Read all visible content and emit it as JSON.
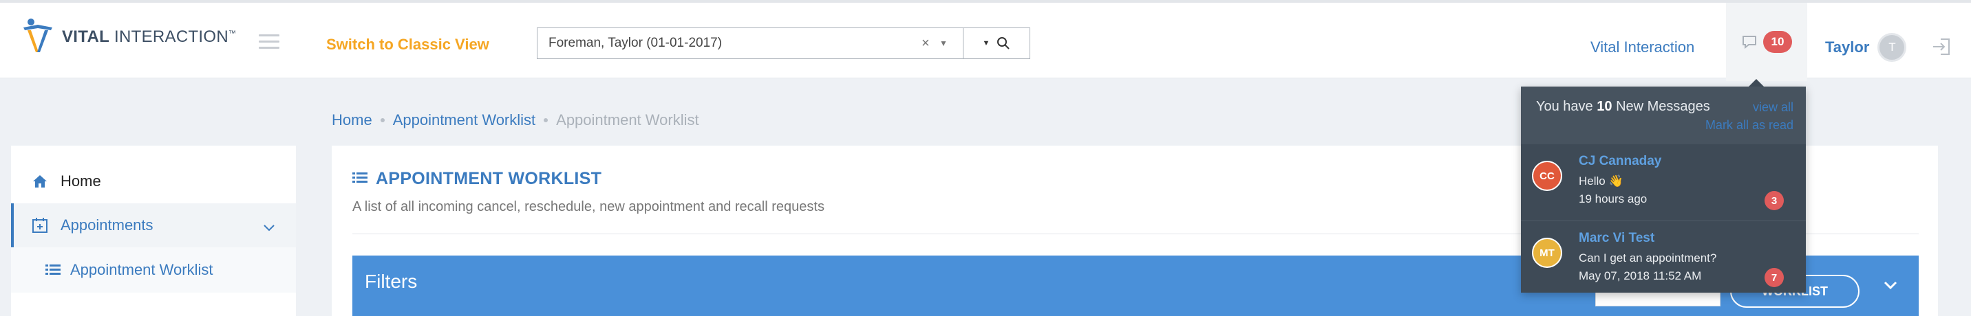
{
  "header": {
    "logo_text_bold": "VITAL",
    "logo_text_rest": "INTERACTION",
    "logo_tm": "™",
    "classic_view": "Switch to Classic View",
    "patient_value": "Foreman, Taylor (01-01-2017)",
    "clear_glyph": "×",
    "vi_link": "Vital Interaction",
    "message_count": "10",
    "user_name": "Taylor",
    "user_initial": "T"
  },
  "breadcrumb": {
    "home": "Home",
    "worklist": "Appointment Worklist",
    "current": "Appointment Worklist"
  },
  "sidebar": {
    "items": [
      {
        "label": "Home",
        "icon": "home-icon"
      },
      {
        "label": "Appointments",
        "icon": "calendar-plus-icon"
      }
    ],
    "sub_items": [
      {
        "label": "Appointment Worklist",
        "icon": "list-icon"
      }
    ]
  },
  "main": {
    "title": "APPOINTMENT WORKLIST",
    "description": "A list of all incoming cancel, reschedule, new appointment and recall requests",
    "filters_title": "Filters",
    "worklist_button": "WORKLIST"
  },
  "notifications": {
    "header_prefix": "You have",
    "header_count": "10",
    "header_suffix": "New Messages",
    "view_all": "view all",
    "mark_all": "Mark all as read",
    "items": [
      {
        "initials": "CC",
        "name": "CJ Cannaday",
        "text": "Hello 👋",
        "time": "19 hours ago",
        "count": "3",
        "color": "#e0583a"
      },
      {
        "initials": "MT",
        "name": "Marc Vi Test",
        "text": "Can I get an appointment?",
        "time": "May 07, 2018 11:52 AM",
        "count": "7",
        "color": "#e8b33c"
      }
    ]
  },
  "colors": {
    "accent": "#3b7bbf",
    "classic_orange": "#f5a623",
    "filters_blue": "#4a90d9",
    "badge_red": "#e05b5b"
  }
}
